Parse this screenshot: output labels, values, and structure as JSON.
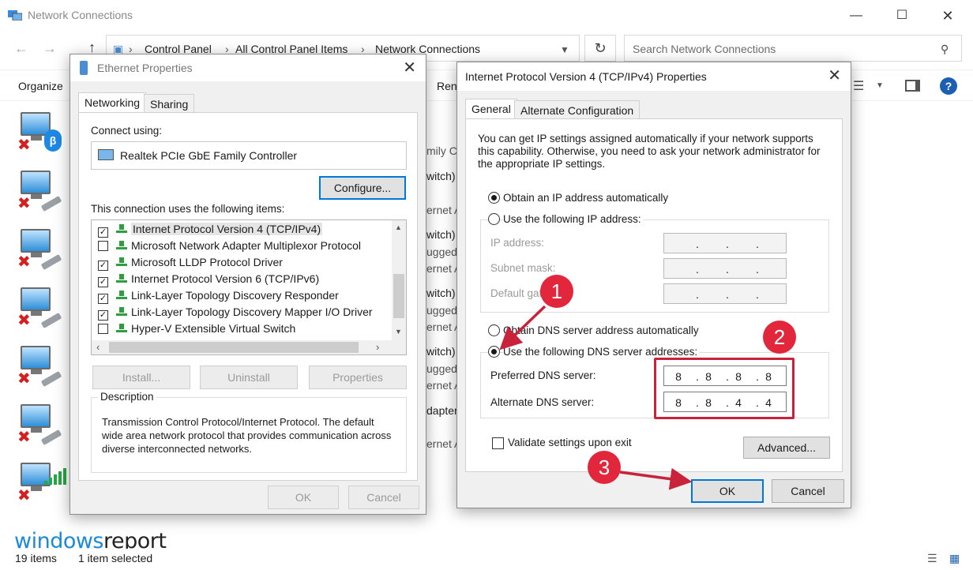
{
  "explorer": {
    "title": "Network Connections",
    "breadcrumb": [
      "Control Panel",
      "All Control Panel Items",
      "Network Connections"
    ],
    "search_placeholder": "Search Network Connections",
    "toolbar": {
      "organize": "Organize",
      "rename_partial": "Ren"
    },
    "background_fragments": [
      "mily C",
      "witch)",
      "ernet A",
      "witch)",
      "ugged",
      "ernet A",
      "witch)",
      "ugged",
      "ernet A",
      "witch)",
      "ugged",
      "ernet A",
      "dapter",
      "ernet A"
    ],
    "status": {
      "items": "19 items",
      "selected": "1 item selected"
    },
    "watermark": {
      "part1": "windows",
      "part2": "report"
    }
  },
  "ethernet": {
    "title": "Ethernet Properties",
    "tabs": [
      "Networking",
      "Sharing"
    ],
    "connect_using_label": "Connect using:",
    "adapter": "Realtek PCIe GbE Family Controller",
    "configure_button": "Configure...",
    "items_label": "This connection uses the following items:",
    "items": [
      {
        "label": "Internet Protocol Version 4 (TCP/IPv4)",
        "checked": true
      },
      {
        "label": "Microsoft Network Adapter Multiplexor Protocol",
        "checked": false
      },
      {
        "label": "Microsoft LLDP Protocol Driver",
        "checked": true
      },
      {
        "label": "Internet Protocol Version 6 (TCP/IPv6)",
        "checked": true
      },
      {
        "label": "Link-Layer Topology Discovery Responder",
        "checked": true
      },
      {
        "label": "Link-Layer Topology Discovery Mapper I/O Driver",
        "checked": true
      },
      {
        "label": "Hyper-V Extensible Virtual Switch",
        "checked": false
      }
    ],
    "buttons": {
      "install": "Install...",
      "uninstall": "Uninstall",
      "properties": "Properties"
    },
    "description_label": "Description",
    "description": "Transmission Control Protocol/Internet Protocol. The default wide area network protocol that provides communication across diverse interconnected networks.",
    "ok": "OK",
    "cancel": "Cancel"
  },
  "ipv4": {
    "title": "Internet Protocol Version 4 (TCP/IPv4) Properties",
    "tabs": [
      "General",
      "Alternate Configuration"
    ],
    "intro": "You can get IP settings assigned automatically if your network supports this capability. Otherwise, you need to ask your network administrator for the appropriate IP settings.",
    "obtain_ip_auto": "Obtain an IP address automatically",
    "use_following_ip": "Use the following IP address:",
    "ip_address_label": "IP address:",
    "subnet_label": "Subnet mask:",
    "gateway_label": "Default gateway:",
    "obtain_dns_auto": "Obtain DNS server address automatically",
    "use_following_dns": "Use the following DNS server addresses:",
    "preferred_dns_label": "Preferred DNS server:",
    "alternate_dns_label": "Alternate DNS server:",
    "preferred_dns": [
      "8",
      "8",
      "8",
      "8"
    ],
    "alternate_dns": [
      "8",
      "8",
      "4",
      "4"
    ],
    "validate_label": "Validate settings upon exit",
    "advanced_button": "Advanced...",
    "ok": "OK",
    "cancel": "Cancel"
  },
  "annotations": {
    "step1": "1",
    "step2": "2",
    "step3": "3",
    "color": "#e2263b"
  }
}
